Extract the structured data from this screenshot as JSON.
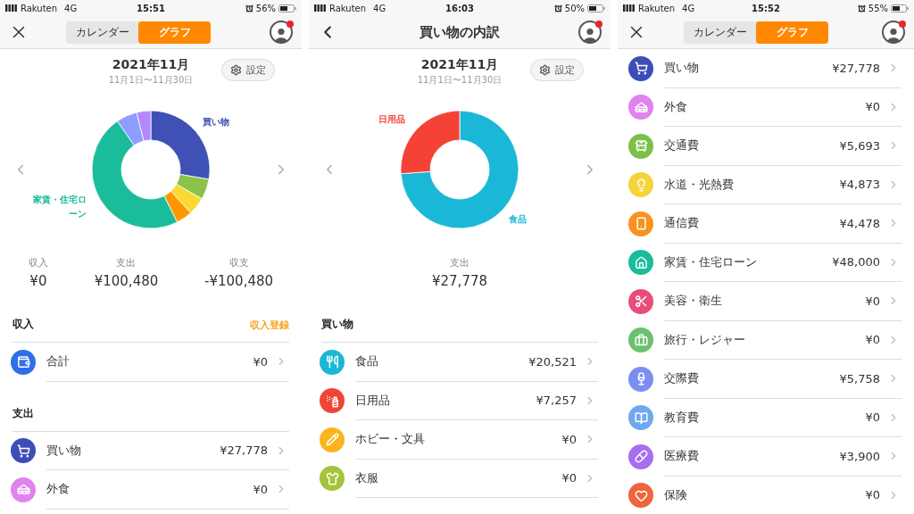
{
  "screens": [
    {
      "status_bar": {
        "carrier": "Rakuten",
        "network": "4G",
        "time": "15:51",
        "battery": "56%"
      },
      "nav": {
        "kind": "tabs",
        "badge": true,
        "tabs": [
          {
            "label": "カレンダー",
            "selected": false
          },
          {
            "label": "グラフ",
            "selected": true
          }
        ]
      },
      "period": {
        "month": "2021年11月",
        "range": "11月1日〜11月30日",
        "settings": "設定"
      },
      "chart": {
        "labels": [
          {
            "text": "買い物",
            "color": "#3f51b5"
          },
          {
            "text": "家賃・住宅ローン",
            "color": "#1abc9c"
          }
        ]
      },
      "summary": [
        {
          "label": "収入",
          "value": "¥0"
        },
        {
          "label": "支出",
          "value": "¥100,480"
        },
        {
          "label": "収支",
          "value": "-¥100,480"
        }
      ],
      "sections": [
        {
          "title": "収入",
          "action": "収入登録",
          "items": [
            {
              "name": "合計",
              "amount": "¥0",
              "color": "#2f6fe8"
            }
          ]
        },
        {
          "title": "支出",
          "items": [
            {
              "name": "買い物",
              "amount": "¥27,778",
              "color": "#3d4db7"
            },
            {
              "name": "外食",
              "amount": "¥0",
              "color": "#e083ec"
            }
          ]
        }
      ]
    },
    {
      "status_bar": {
        "carrier": "Rakuten",
        "network": "4G",
        "time": "16:03",
        "battery": "50%"
      },
      "nav": {
        "kind": "title",
        "badge": true,
        "title": "買い物の内訳"
      },
      "period": {
        "month": "2021年11月",
        "range": "11月1日〜11月30日",
        "settings": "設定"
      },
      "chart": {
        "labels": [
          {
            "text": "日用品",
            "color": "#f44336"
          },
          {
            "text": "食品",
            "color": "#1ab8d6"
          }
        ]
      },
      "summary": [
        {
          "label": "支出",
          "value": "¥27,778"
        }
      ],
      "sections": [
        {
          "title": "買い物",
          "items": [
            {
              "name": "食品",
              "amount": "¥20,521",
              "color": "#1ab8d6"
            },
            {
              "name": "日用品",
              "amount": "¥7,257",
              "color": "#f04535"
            },
            {
              "name": "ホビー・文具",
              "amount": "¥0",
              "color": "#fbb41e"
            },
            {
              "name": "衣服",
              "amount": "¥0",
              "color": "#a4c43a"
            }
          ]
        }
      ]
    },
    {
      "status_bar": {
        "carrier": "Rakuten",
        "network": "4G",
        "time": "15:52",
        "battery": "55%"
      },
      "nav": {
        "kind": "tabs",
        "badge": true,
        "tabs": [
          {
            "label": "カレンダー",
            "selected": false
          },
          {
            "label": "グラフ",
            "selected": true
          }
        ]
      },
      "sections": [
        {
          "items": [
            {
              "name": "買い物",
              "amount": "¥27,778",
              "color": "#3d4db7"
            },
            {
              "name": "外食",
              "amount": "¥0",
              "color": "#e083ec"
            },
            {
              "name": "交通費",
              "amount": "¥5,693",
              "color": "#7cc04a"
            },
            {
              "name": "水道・光熱費",
              "amount": "¥4,873",
              "color": "#f5d33a"
            },
            {
              "name": "通信費",
              "amount": "¥4,478",
              "color": "#f7931e"
            },
            {
              "name": "家賃・住宅ローン",
              "amount": "¥48,000",
              "color": "#1abc9c"
            },
            {
              "name": "美容・衛生",
              "amount": "¥0",
              "color": "#e84d7a"
            },
            {
              "name": "旅行・レジャー",
              "amount": "¥0",
              "color": "#6cc070"
            },
            {
              "name": "交際費",
              "amount": "¥5,758",
              "color": "#7b8ff0"
            },
            {
              "name": "教育費",
              "amount": "¥0",
              "color": "#6fa8f0"
            },
            {
              "name": "医療費",
              "amount": "¥3,900",
              "color": "#a66ef0"
            },
            {
              "name": "保険",
              "amount": "¥0",
              "color": "#f0643c"
            }
          ]
        }
      ]
    }
  ]
}
